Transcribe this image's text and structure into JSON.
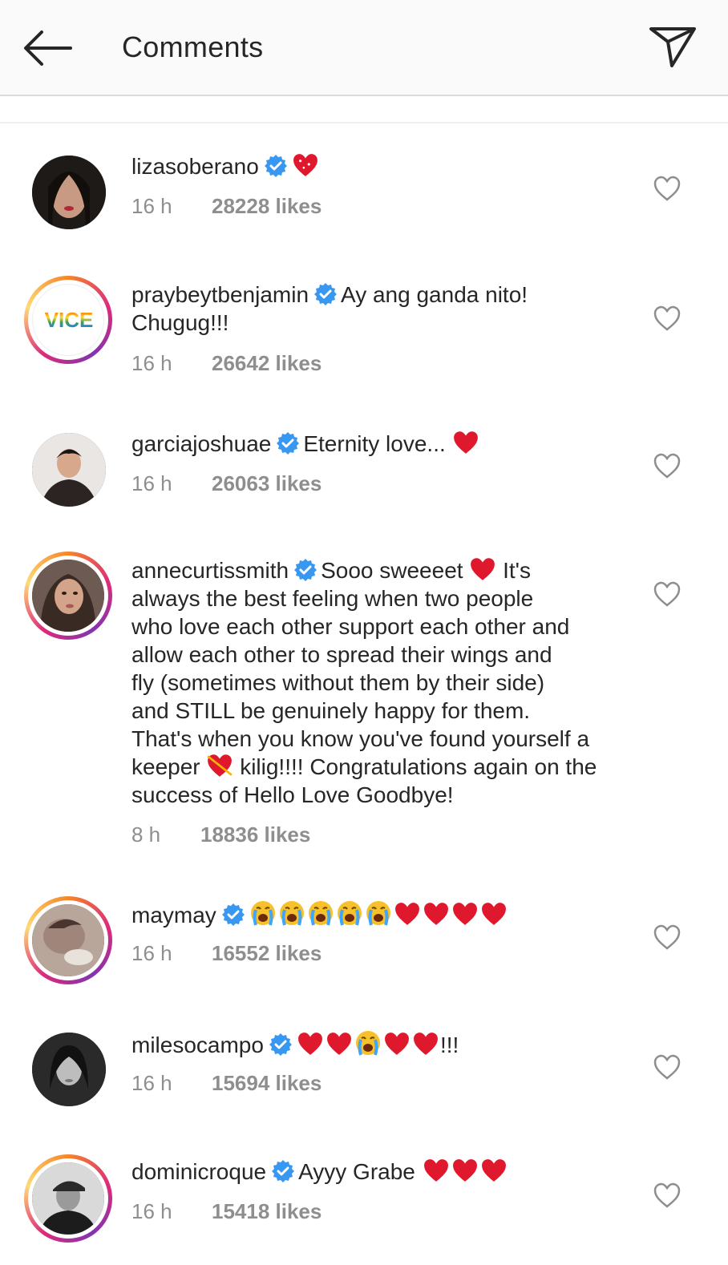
{
  "header": {
    "title": "Comments"
  },
  "comments": [
    {
      "username": "lizasoberano",
      "text": "",
      "time": "16 h",
      "likes": "28228 likes"
    },
    {
      "username": "praybeytbenjamin",
      "text": "Ay ang ganda nito!",
      "text2": "Chugug!!!",
      "avatar_text": "VICE",
      "time": "16 h",
      "likes": "26642 likes"
    },
    {
      "username": "garciajoshuae",
      "text": "Eternity love...",
      "time": "16 h",
      "likes": "26063 likes"
    },
    {
      "username": "annecurtissmith",
      "text_a": "Sooo sweeeet",
      "text_b": "It's",
      "lines": [
        "always the best feeling when two people",
        "who love each other support each other and",
        "allow each other to spread their wings and",
        "fly (sometimes without them by their side)",
        "and STILL be genuinely happy for them.",
        "That's when you know you've found yourself a"
      ],
      "line_keeper_a": "keeper",
      "line_keeper_b": "kilig!!!! Congratulations again on the",
      "line_last": "success of Hello Love Goodbye!",
      "time": "8 h",
      "likes": "18836 likes"
    },
    {
      "username": "maymay",
      "text": "",
      "time": "16 h",
      "likes": "16552 likes"
    },
    {
      "username": "milesocampo",
      "text": "!!!",
      "time": "16 h",
      "likes": "15694 likes"
    },
    {
      "username": "dominicroque",
      "text": "Ayyy Grabe",
      "time": "16 h",
      "likes": "15418 likes"
    }
  ],
  "colors": {
    "verified": "#3897f0",
    "heart": "#ed4956",
    "meta": "#8e8e8e"
  },
  "icons": {
    "back": "arrow-left-icon",
    "share": "paper-plane-icon",
    "like": "heart-outline-icon",
    "badge": "verified-badge-icon"
  }
}
